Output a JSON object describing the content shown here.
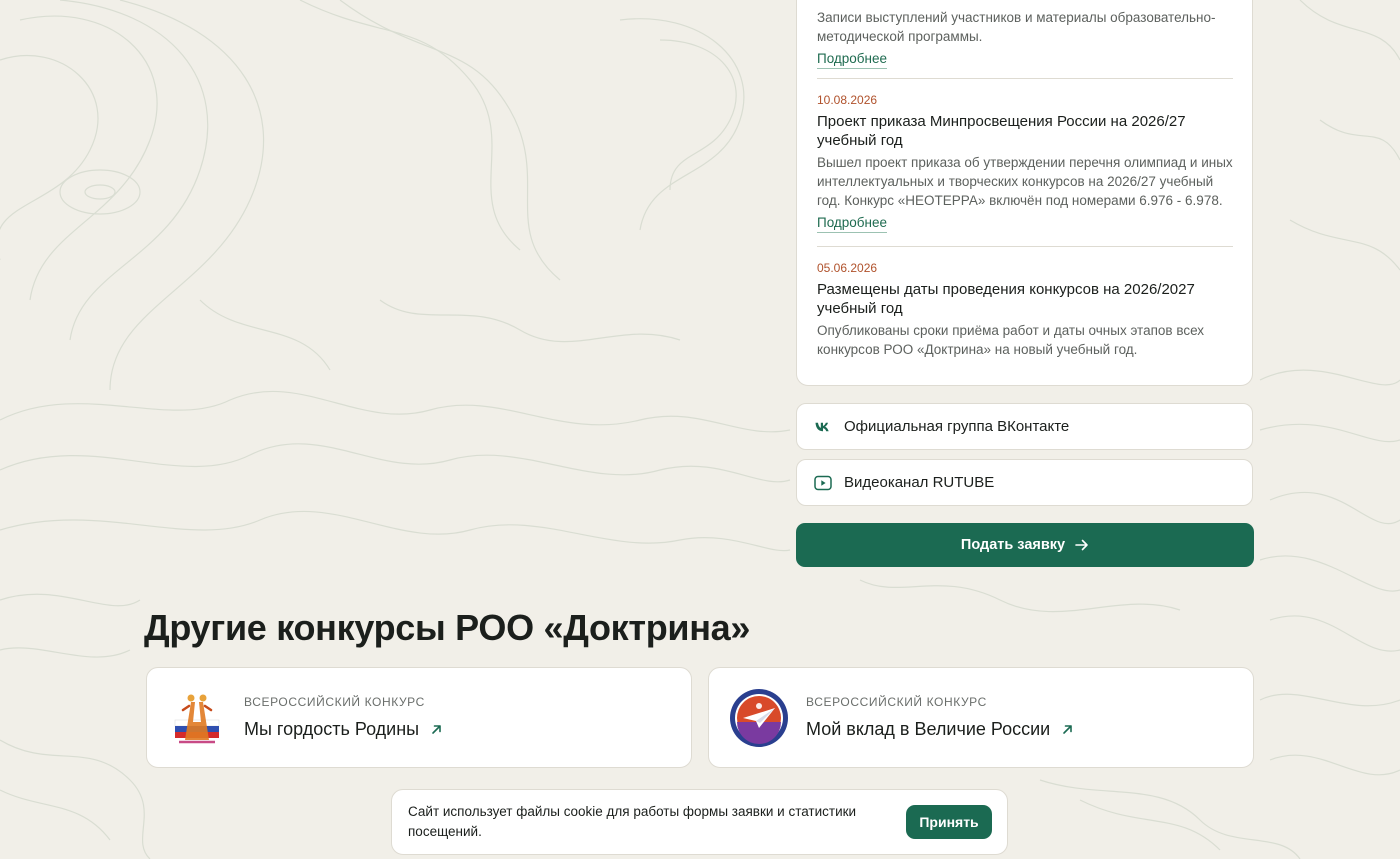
{
  "news": {
    "items": [
      {
        "date": "",
        "title": "",
        "description": "Записи выступлений участников и материалы образовательно-методической программы.",
        "more_label": "Подробнее"
      },
      {
        "date": "10.08.2026",
        "title": "Проект приказа Минпросвещения России на 2026/27 учебный год",
        "description": "Вышел проект приказа об утверждении перечня олимпиад и иных интеллектуальных и творческих конкурсов на 2026/27 учебный год. Конкурс «НЕОТЕРРА» включён под номерами 6.976 - 6.978.",
        "more_label": "Подробнее"
      },
      {
        "date": "05.06.2026",
        "title": "Размещены даты проведения конкурсов на 2026/2027 учебный год",
        "description": "Опубликованы сроки приёма работ и даты очных этапов всех конкурсов РОО «Доктрина» на новый учебный год."
      }
    ]
  },
  "links": {
    "vk": {
      "label": "Официальная группа ВКонтакте",
      "icon": "vk-icon"
    },
    "rutube": {
      "label": "Видеоканал RUTUBE",
      "icon": "video-play-icon"
    }
  },
  "apply_button": {
    "label": "Подать заявку",
    "icon": "arrow-right-icon"
  },
  "other_contests": {
    "title": "Другие конкурсы РОО «Доктрина»",
    "items": [
      {
        "kicker": "ВСЕРОССИЙСКИЙ КОНКУРС",
        "name": "Мы гордость Родины",
        "icon": "arrow-up-right-icon"
      },
      {
        "kicker": "ВСЕРОССИЙСКИЙ КОНКУРС",
        "name": "Мой вклад в Величие России",
        "icon": "arrow-up-right-icon"
      }
    ]
  },
  "cookie_banner": {
    "text": "Сайт использует файлы cookie для работы формы заявки и статистики посещений.",
    "accept_label": "Принять"
  },
  "colors": {
    "background": "#f1efe8",
    "accent": "#1b6a52",
    "date": "#b0522c",
    "card": "#ffffff"
  }
}
